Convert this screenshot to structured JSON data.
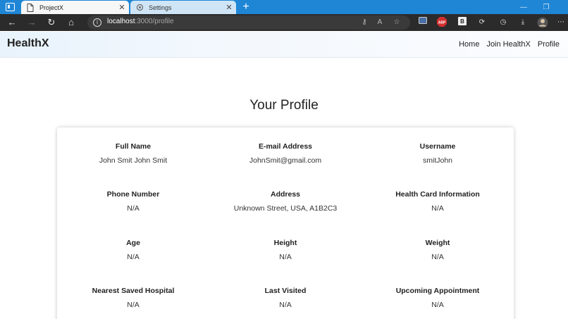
{
  "browser": {
    "tabs": [
      {
        "label": "ProjectX",
        "active": true
      },
      {
        "label": "Settings",
        "active": false
      }
    ],
    "new_tab": "+",
    "url_host": "localhost",
    "url_path": ":3000/profile"
  },
  "navbar": {
    "brand": "HealthX",
    "links": [
      "Home",
      "Join HealthX",
      "Profile"
    ]
  },
  "page": {
    "title": "Your Profile"
  },
  "profile": {
    "fields": [
      {
        "label": "Full Name",
        "value": "John Smit John Smit"
      },
      {
        "label": "E-mail Address",
        "value": "JohnSmit@gmail.com"
      },
      {
        "label": "Username",
        "value": "smitJohn"
      },
      {
        "label": "Phone Number",
        "value": "N/A"
      },
      {
        "label": "Address",
        "value": "Unknown Street, USA, A1B2C3"
      },
      {
        "label": "Health Card Information",
        "value": "N/A"
      },
      {
        "label": "Age",
        "value": "N/A"
      },
      {
        "label": "Height",
        "value": "N/A"
      },
      {
        "label": "Weight",
        "value": "N/A"
      },
      {
        "label": "Nearest Saved Hospital",
        "value": "N/A"
      },
      {
        "label": "Last Visited",
        "value": "N/A"
      },
      {
        "label": "Upcoming Appointment",
        "value": "N/A"
      }
    ]
  },
  "colors": {
    "tabstrip": "#1f86d6",
    "toolbar": "#2b2b2b",
    "navbar_start": "#e8f3fc"
  }
}
